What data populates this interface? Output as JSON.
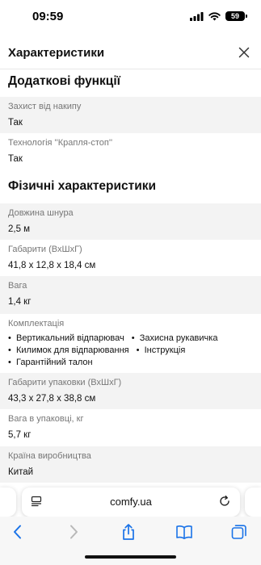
{
  "status_bar": {
    "time": "09:59",
    "battery_level": "59"
  },
  "header": {
    "title": "Характеристики"
  },
  "sections": [
    {
      "title": "Додаткові функції",
      "rows": [
        {
          "label": "Захист від накипу",
          "value": "Так"
        },
        {
          "label": "Технологія ''Крапля-стоп''",
          "value": "Так"
        }
      ]
    },
    {
      "title": "Фізичні характеристики",
      "rows": [
        {
          "label": "Довжина шнура",
          "value": "2,5 м"
        },
        {
          "label": "Габарити (ВхШхГ)",
          "value": "41,8 x 12,8 x 18,4 см"
        },
        {
          "label": "Вага",
          "value": "1,4 кг"
        },
        {
          "label": "Комплектація",
          "items": [
            "Вертикальний відпарювач",
            "Захисна рукавичка",
            "Килимок для відпарювання",
            "Інструкція",
            "Гарантійний талон"
          ]
        },
        {
          "label": "Габарити упаковки (ВхШхГ)",
          "value": "43,3 x 27,8 x 38,8 см"
        },
        {
          "label": "Вага в упаковці, кг",
          "value": "5,7 кг"
        },
        {
          "label": "Країна виробництва",
          "value": "Китай"
        }
      ]
    }
  ],
  "browser": {
    "url": "comfy.ua"
  },
  "colors": {
    "accent": "#1a73e8",
    "row_grey": "#f3f3f3",
    "label_grey": "#777777"
  }
}
